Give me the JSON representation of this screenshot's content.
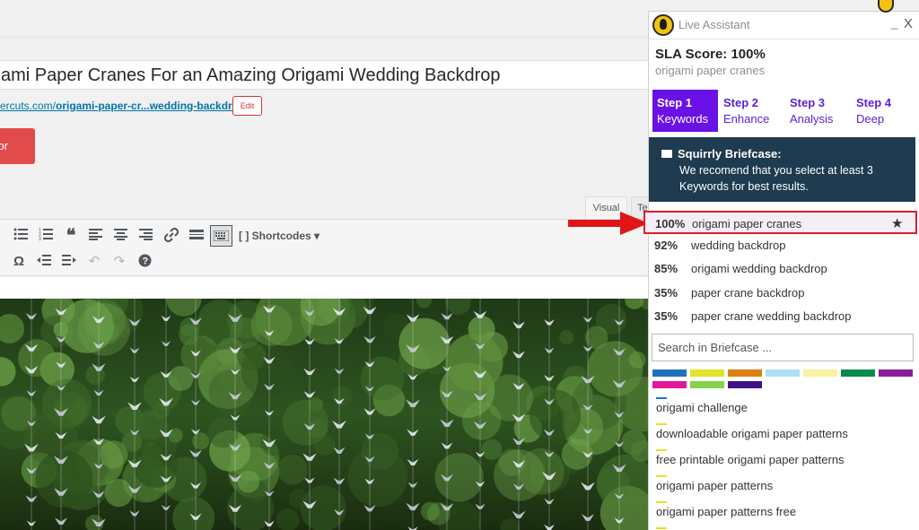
{
  "editor": {
    "post_title": "ami Paper Cranes For an Amazing Origami Wedding Backdrop",
    "permalink_prefix": "ercuts.com/",
    "permalink_slug": "origami-paper-cr...wedding-backdrop",
    "permalink_suffix": "/",
    "edit_label": "Edit",
    "red_button_label": "or",
    "tab_visual": "Visual",
    "tab_text": "Te",
    "shortcodes_label": "[ ] Shortcodes ▾"
  },
  "assistant": {
    "title": "Live Assistant",
    "minimize": "_",
    "close": "X",
    "sla_score": "SLA Score: 100%",
    "sla_keyword": "origami paper cranes",
    "steps": [
      {
        "num": "Step 1",
        "label": "Keywords"
      },
      {
        "num": "Step 2",
        "label": "Enhance"
      },
      {
        "num": "Step 3",
        "label": "Analysis"
      },
      {
        "num": "Step 4",
        "label": "Deep"
      }
    ],
    "briefcase_title": "Squirrly Briefcase:",
    "briefcase_msg": "We recomend that you select at least 3 Keywords for best results.",
    "keywords": [
      {
        "pct": "100%",
        "kw": "origami paper cranes"
      },
      {
        "pct": "92%",
        "kw": "wedding backdrop"
      },
      {
        "pct": "85%",
        "kw": "origami wedding backdrop"
      },
      {
        "pct": "35%",
        "kw": "paper crane backdrop"
      },
      {
        "pct": "35%",
        "kw": "paper crane wedding backdrop"
      }
    ],
    "search_placeholder": "Search in Briefcase ...",
    "label_colors": [
      "#1e73be",
      "#e2e22a",
      "#dd7e10",
      "#aee0f2",
      "#f9f2a0",
      "#078b4a",
      "#8b1c9b",
      "#e0199b",
      "#86d34b",
      "#3b1486"
    ],
    "briefcase_items": [
      {
        "text": "origami challenge",
        "color": "#1e73be"
      },
      {
        "text": "downloadable origami paper patterns",
        "color": "#e2e22a"
      },
      {
        "text": "free printable origami paper patterns",
        "color": "#e2e22a"
      },
      {
        "text": "origami paper patterns",
        "color": "#e2e22a"
      },
      {
        "text": "origami paper patterns free",
        "color": "#e2e22a"
      }
    ]
  }
}
